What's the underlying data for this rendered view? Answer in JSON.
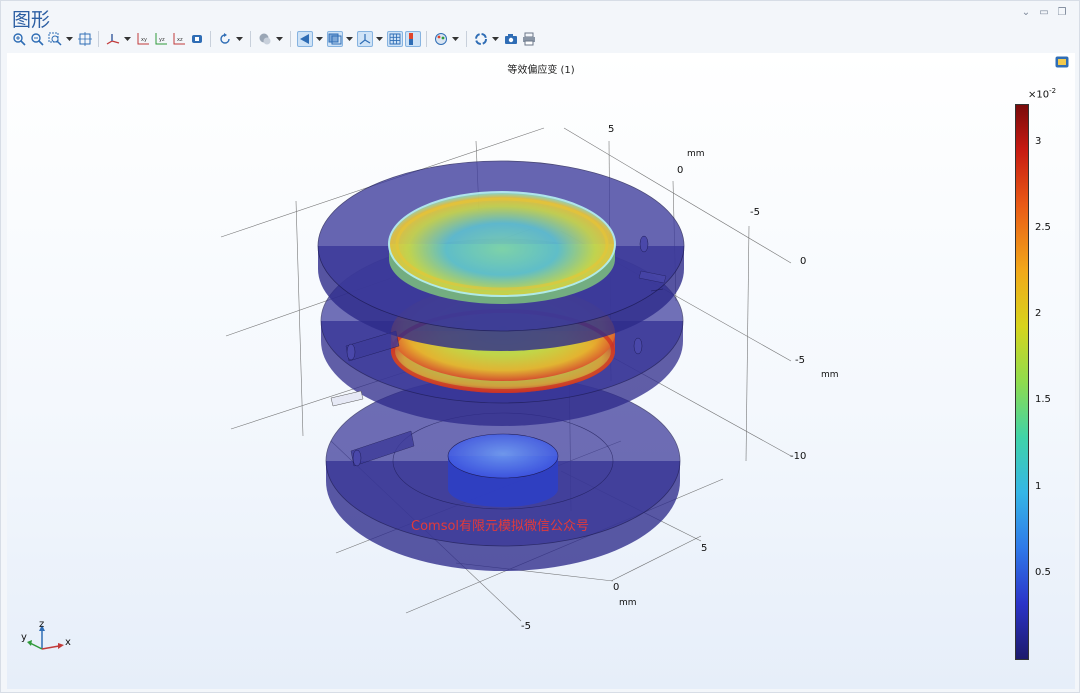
{
  "window": {
    "title": "图形"
  },
  "plot": {
    "title": "等效偏应变 (1)",
    "watermark": "Comsol有限元模拟微信公众号"
  },
  "axes": {
    "y_ticks": [
      "5",
      "0",
      "-5"
    ],
    "y_unit": "mm",
    "z_ticks": [
      "0",
      "-5",
      "-10"
    ],
    "z_unit": "mm",
    "x_ticks": [
      "5",
      "0",
      "-5"
    ],
    "x_unit": "mm",
    "triad": {
      "x": "x",
      "y": "y",
      "z": "z"
    }
  },
  "colorbar": {
    "exponent_base": "×10",
    "exponent_power": "-2",
    "ticks": [
      "3",
      "2.5",
      "2",
      "1.5",
      "1",
      "0.5"
    ]
  },
  "toolbar": {
    "icons": [
      "zoom-in-icon",
      "zoom-out-icon",
      "zoom-box-icon",
      "zoom-extents-icon",
      "axis-orientation-icon",
      "view-xy-icon",
      "view-yz-icon",
      "view-xz-icon",
      "go-to-default-view-icon",
      "rotate-icon",
      "lighting-icon",
      "scene-light-icon",
      "transparency-icon",
      "grid-icon",
      "axis-icon",
      "legend-icon",
      "color-table-icon",
      "render-icon",
      "camera-icon",
      "print-icon"
    ]
  },
  "colors": {
    "title": "#2d5fa3",
    "disk": "#2d2a8a",
    "watermark": "#e23a3a"
  }
}
